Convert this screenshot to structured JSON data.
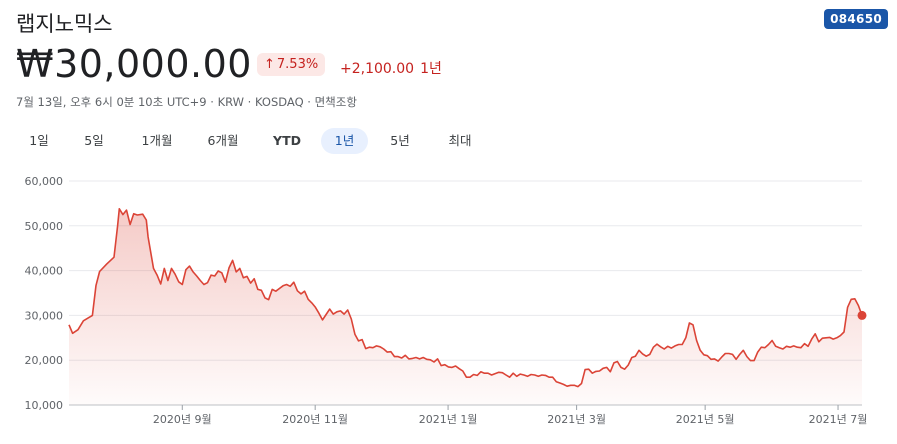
{
  "stock": {
    "name": "랩지노믹스",
    "ticker": "084650",
    "price": "₩30,000.00",
    "change_pct": "7.53%",
    "change_arrow": "↑",
    "change_abs": "+2,100.00",
    "change_period": "1년",
    "meta": "7월 13일, 오후 6시 0분 10초 UTC+9 · KRW · KOSDAQ · 면책조항"
  },
  "tabs": [
    {
      "label": "1일"
    },
    {
      "label": "5일"
    },
    {
      "label": "1개월"
    },
    {
      "label": "6개월"
    },
    {
      "label": "YTD"
    },
    {
      "label": "1년",
      "active": true
    },
    {
      "label": "5년"
    },
    {
      "label": "최대"
    }
  ],
  "colors": {
    "line": "#db4437",
    "accent": "#1a56a8",
    "chip_bg": "#fce8e6"
  },
  "chart_data": {
    "type": "area",
    "y_ticks": [
      "60,000",
      "50,000",
      "40,000",
      "30,000",
      "20,000",
      "10,000"
    ],
    "ylim": [
      10000,
      60000
    ],
    "x_ticks": [
      "2020년 9월",
      "2020년 11월",
      "2021년 1월",
      "2021년 3월",
      "2021년 5월",
      "2021년 7월"
    ],
    "x_tick_days": [
      52,
      113,
      174,
      233,
      292,
      353
    ],
    "xlim": [
      0,
      364
    ],
    "grid": true,
    "series": [
      {
        "values": [
          [
            0,
            27900
          ],
          [
            2,
            26000
          ],
          [
            5,
            26800
          ],
          [
            8,
            28800
          ],
          [
            11,
            29500
          ],
          [
            13,
            30000
          ],
          [
            15,
            36700
          ],
          [
            17,
            39800
          ],
          [
            21,
            41500
          ],
          [
            25,
            43000
          ],
          [
            27,
            50000
          ],
          [
            28,
            53800
          ],
          [
            30,
            52500
          ],
          [
            32,
            53500
          ],
          [
            34,
            50300
          ],
          [
            36,
            52700
          ],
          [
            38,
            52400
          ],
          [
            41,
            52600
          ],
          [
            43,
            51300
          ],
          [
            44,
            47500
          ],
          [
            47,
            40500
          ],
          [
            49,
            39000
          ],
          [
            51,
            37000
          ],
          [
            53,
            40500
          ],
          [
            55,
            37800
          ],
          [
            57,
            40500
          ],
          [
            59,
            39200
          ],
          [
            61,
            37500
          ],
          [
            63,
            36900
          ],
          [
            65,
            40200
          ],
          [
            67,
            41000
          ],
          [
            69,
            39700
          ],
          [
            71,
            38800
          ],
          [
            73,
            37800
          ],
          [
            75,
            36900
          ],
          [
            77,
            37300
          ],
          [
            79,
            39000
          ],
          [
            81,
            38800
          ],
          [
            83,
            39900
          ],
          [
            85,
            39500
          ],
          [
            87,
            37400
          ],
          [
            89,
            40600
          ],
          [
            91,
            42300
          ],
          [
            93,
            39700
          ],
          [
            95,
            40500
          ],
          [
            97,
            38400
          ],
          [
            99,
            38700
          ],
          [
            101,
            37200
          ],
          [
            103,
            38200
          ],
          [
            105,
            35800
          ],
          [
            107,
            35600
          ],
          [
            109,
            33900
          ],
          [
            111,
            33500
          ],
          [
            113,
            35800
          ],
          [
            115,
            35400
          ],
          [
            117,
            36000
          ],
          [
            119,
            36600
          ],
          [
            121,
            36900
          ],
          [
            123,
            36500
          ],
          [
            125,
            37400
          ],
          [
            127,
            35500
          ],
          [
            129,
            34800
          ],
          [
            131,
            35400
          ],
          [
            133,
            33600
          ],
          [
            135,
            32800
          ],
          [
            137,
            31800
          ],
          [
            139,
            30500
          ],
          [
            141,
            29000
          ],
          [
            143,
            30200
          ],
          [
            145,
            31400
          ],
          [
            147,
            30300
          ],
          [
            149,
            30800
          ],
          [
            151,
            31000
          ],
          [
            153,
            30300
          ],
          [
            155,
            31200
          ],
          [
            157,
            29200
          ],
          [
            159,
            25800
          ],
          [
            161,
            24300
          ],
          [
            163,
            24600
          ],
          [
            165,
            22600
          ],
          [
            167,
            22900
          ],
          [
            169,
            22800
          ],
          [
            171,
            23200
          ],
          [
            173,
            23000
          ],
          [
            175,
            22500
          ],
          [
            177,
            21800
          ],
          [
            179,
            21900
          ],
          [
            181,
            20800
          ],
          [
            183,
            20800
          ],
          [
            185,
            20500
          ],
          [
            187,
            21100
          ],
          [
            189,
            20300
          ],
          [
            191,
            20400
          ],
          [
            193,
            20600
          ],
          [
            195,
            20300
          ],
          [
            197,
            20600
          ],
          [
            199,
            20200
          ],
          [
            201,
            20100
          ],
          [
            203,
            19600
          ],
          [
            205,
            20300
          ],
          [
            207,
            18800
          ],
          [
            209,
            19000
          ],
          [
            211,
            18500
          ],
          [
            213,
            18400
          ],
          [
            215,
            18700
          ],
          [
            217,
            18100
          ],
          [
            219,
            17600
          ],
          [
            221,
            16200
          ],
          [
            223,
            16200
          ],
          [
            225,
            16800
          ],
          [
            227,
            16600
          ],
          [
            229,
            17400
          ],
          [
            231,
            17100
          ],
          [
            233,
            17100
          ],
          [
            235,
            16700
          ],
          [
            237,
            17000
          ],
          [
            239,
            17300
          ],
          [
            241,
            17200
          ],
          [
            243,
            16700
          ],
          [
            245,
            16200
          ],
          [
            247,
            17100
          ],
          [
            249,
            16400
          ],
          [
            251,
            16900
          ],
          [
            253,
            16700
          ],
          [
            255,
            16400
          ],
          [
            257,
            16800
          ],
          [
            259,
            16700
          ],
          [
            261,
            16400
          ],
          [
            263,
            16700
          ],
          [
            265,
            16600
          ],
          [
            267,
            16200
          ],
          [
            269,
            16200
          ],
          [
            271,
            15200
          ],
          [
            273,
            14900
          ],
          [
            275,
            14600
          ],
          [
            277,
            14200
          ],
          [
            279,
            14400
          ],
          [
            281,
            14400
          ],
          [
            283,
            14100
          ],
          [
            285,
            14800
          ],
          [
            287,
            17900
          ],
          [
            289,
            18000
          ],
          [
            291,
            17100
          ],
          [
            293,
            17500
          ],
          [
            295,
            17600
          ],
          [
            297,
            18200
          ],
          [
            299,
            18400
          ],
          [
            301,
            17400
          ],
          [
            303,
            19400
          ],
          [
            305,
            19700
          ],
          [
            307,
            18400
          ],
          [
            309,
            18000
          ],
          [
            311,
            18900
          ],
          [
            313,
            20600
          ],
          [
            315,
            20900
          ],
          [
            317,
            22200
          ],
          [
            319,
            21400
          ],
          [
            321,
            20900
          ],
          [
            323,
            21300
          ],
          [
            325,
            22900
          ],
          [
            327,
            23600
          ],
          [
            329,
            23000
          ],
          [
            331,
            22500
          ],
          [
            333,
            23100
          ],
          [
            335,
            22700
          ],
          [
            337,
            23200
          ],
          [
            339,
            23500
          ],
          [
            341,
            23500
          ],
          [
            343,
            25000
          ],
          [
            345,
            28300
          ],
          [
            347,
            27900
          ],
          [
            349,
            24400
          ],
          [
            351,
            22200
          ],
          [
            353,
            21200
          ],
          [
            355,
            21000
          ],
          [
            357,
            20200
          ],
          [
            359,
            20300
          ],
          [
            361,
            19800
          ],
          [
            363,
            20700
          ],
          [
            365,
            21500
          ],
          [
            367,
            21500
          ],
          [
            369,
            21300
          ],
          [
            371,
            20200
          ],
          [
            373,
            21300
          ],
          [
            375,
            22200
          ],
          [
            377,
            20800
          ],
          [
            379,
            19900
          ],
          [
            381,
            19900
          ],
          [
            383,
            21800
          ],
          [
            385,
            22900
          ],
          [
            387,
            22800
          ],
          [
            389,
            23500
          ],
          [
            391,
            24400
          ],
          [
            393,
            23100
          ],
          [
            395,
            22800
          ],
          [
            397,
            22500
          ],
          [
            399,
            23100
          ],
          [
            401,
            22900
          ],
          [
            403,
            23200
          ],
          [
            405,
            22900
          ],
          [
            407,
            22800
          ],
          [
            409,
            23700
          ],
          [
            411,
            23100
          ],
          [
            413,
            24700
          ],
          [
            415,
            25900
          ],
          [
            417,
            24100
          ],
          [
            419,
            24900
          ],
          [
            421,
            25000
          ],
          [
            423,
            25100
          ],
          [
            425,
            24700
          ],
          [
            427,
            25000
          ],
          [
            429,
            25500
          ],
          [
            431,
            26300
          ],
          [
            433,
            31800
          ],
          [
            435,
            33600
          ],
          [
            437,
            33700
          ],
          [
            439,
            32200
          ],
          [
            441,
            30000
          ]
        ]
      }
    ]
  }
}
